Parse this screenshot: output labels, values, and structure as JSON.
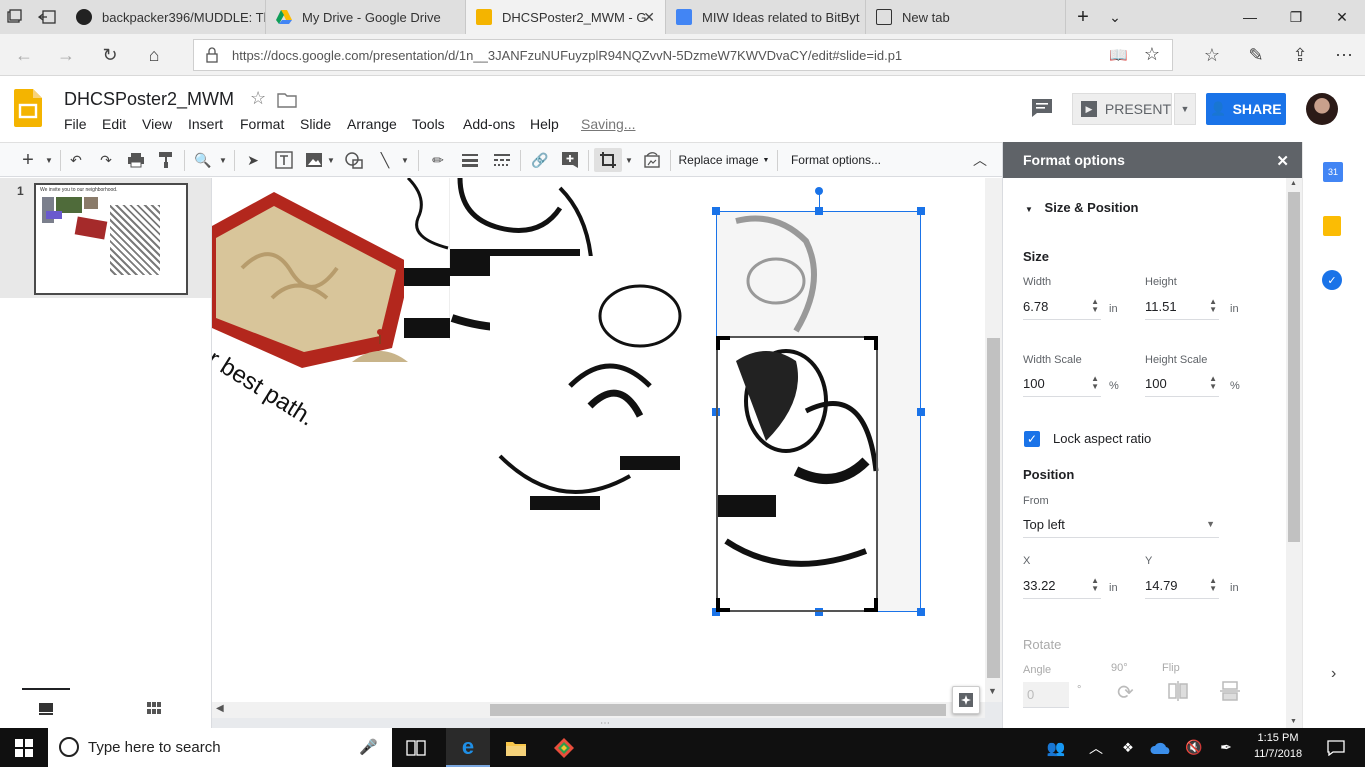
{
  "browser": {
    "tabs": [
      {
        "title": "backpacker396/MUDDLE: Th",
        "icon": "github-icon",
        "active": false
      },
      {
        "title": "My Drive - Google Drive",
        "icon": "google-drive-icon",
        "active": false
      },
      {
        "title": "DHCSPoster2_MWM - G",
        "icon": "google-slides-icon",
        "active": true
      },
      {
        "title": "MIW Ideas related to BitByt",
        "icon": "google-docs-icon",
        "active": false
      },
      {
        "title": "New tab",
        "icon": "new-tab-page-icon",
        "active": false
      }
    ],
    "url": "https://docs.google.com/presentation/d/1n__3JANFzuNUFuyzplR94NQZvvN-5DzmeW7KWVDvaCY/edit#slide=id.p1"
  },
  "app": {
    "doc_title": "DHCSPoster2_MWM",
    "menus": [
      "File",
      "Edit",
      "View",
      "Insert",
      "Format",
      "Slide",
      "Arrange",
      "Tools",
      "Add-ons",
      "Help"
    ],
    "saving_status": "Saving...",
    "present_label": "PRESENT",
    "share_label": "SHARE",
    "accent_color": "#1a73e8",
    "slides_color": "#f4b400"
  },
  "toolbar": {
    "replace_image": "Replace image",
    "format_options": "Format options..."
  },
  "filmstrip": {
    "slide_number": "1",
    "thumb_text": "We invite you to our neighborhood."
  },
  "slide": {
    "path_text": "ur best path."
  },
  "format_panel": {
    "title": "Format options",
    "section": "Size & Position",
    "size_label": "Size",
    "width_label": "Width",
    "width_value": "6.78",
    "height_label": "Height",
    "height_value": "11.51",
    "unit_in": "in",
    "width_scale_label": "Width Scale",
    "width_scale_value": "100",
    "height_scale_label": "Height Scale",
    "height_scale_value": "100",
    "unit_pct": "%",
    "lock_label": "Lock aspect ratio",
    "position_label": "Position",
    "from_label": "From",
    "from_value": "Top left",
    "x_label": "X",
    "x_value": "33.22",
    "y_label": "Y",
    "y_value": "14.79",
    "rotate_label": "Rotate",
    "angle_label": "Angle",
    "angle_value": "0",
    "deg_unit": "°",
    "rot90_label": "90°",
    "flip_label": "Flip"
  },
  "taskbar": {
    "search_placeholder": "Type here to search",
    "time": "1:15 PM",
    "date": "11/7/2018"
  }
}
